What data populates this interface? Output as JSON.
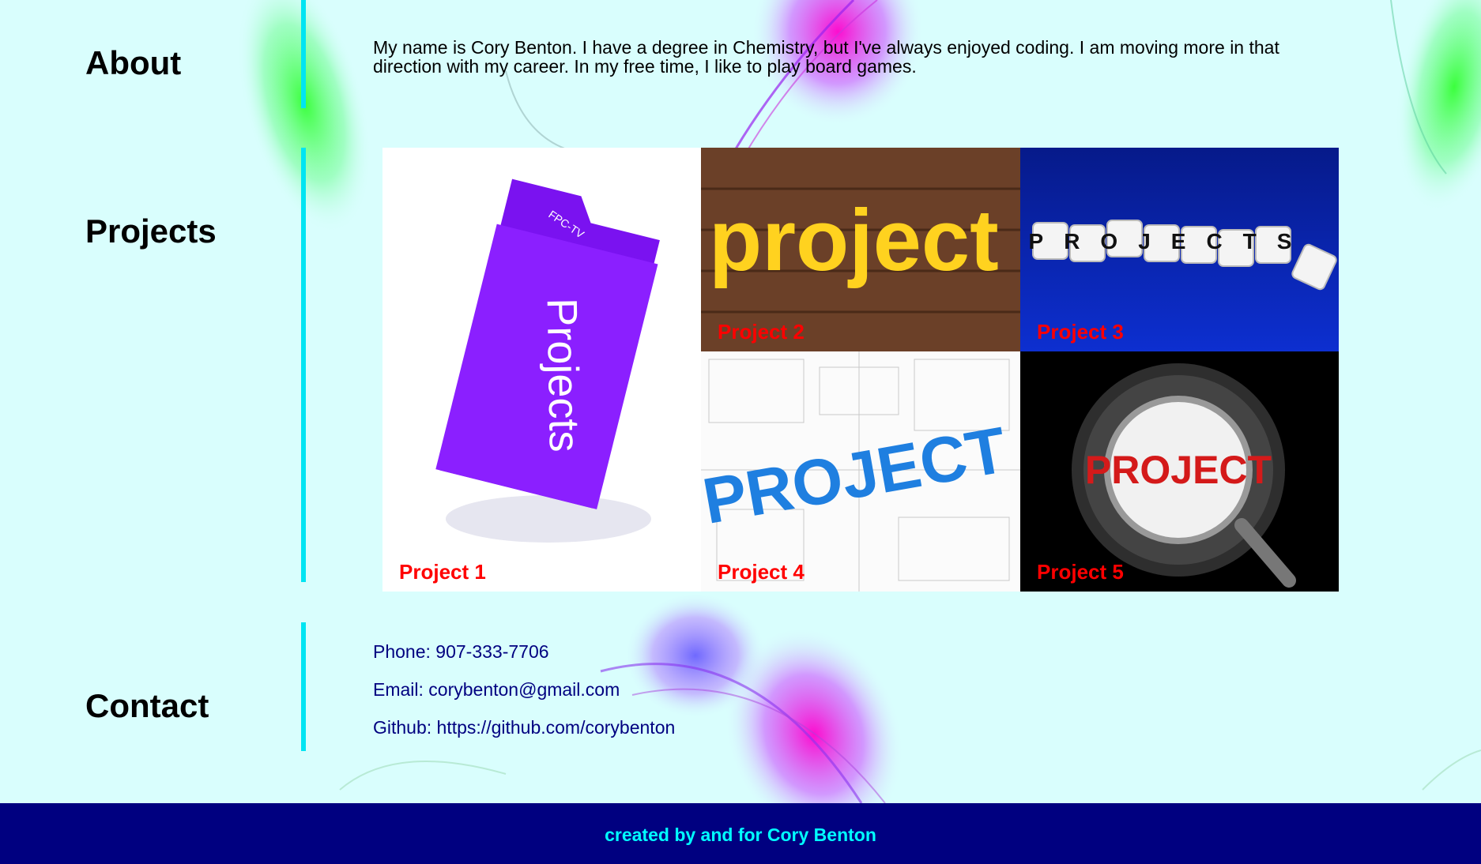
{
  "about": {
    "heading": "About",
    "text": "My name is Cory Benton. I have a degree in Chemistry, but I've always enjoyed coding. I am moving more in that direction with my career. In my free time, I like to play board games."
  },
  "projects": {
    "heading": "Projects",
    "items": [
      {
        "label": "Project 1",
        "image_text": "Projects",
        "image_subtext": "FPC-TV"
      },
      {
        "label": "Project 2",
        "image_text": "project"
      },
      {
        "label": "Project 3",
        "image_text": "PROJECTS"
      },
      {
        "label": "Project 4",
        "image_text": "PROJECT"
      },
      {
        "label": "Project 5",
        "image_text": "PROJECT"
      }
    ]
  },
  "contact": {
    "heading": "Contact",
    "phone": "Phone: 907-333-7706",
    "email": "Email: corybenton@gmail.com",
    "github": "Github: https://github.com/corybenton"
  },
  "footer": {
    "text": "created by and for Cory Benton"
  },
  "colors": {
    "background": "#d9fefd",
    "divider": "#00e5f2",
    "footer_bg": "#000080",
    "footer_text": "#00ffff",
    "project_label": "#ff0000",
    "contact_text": "#000080"
  }
}
